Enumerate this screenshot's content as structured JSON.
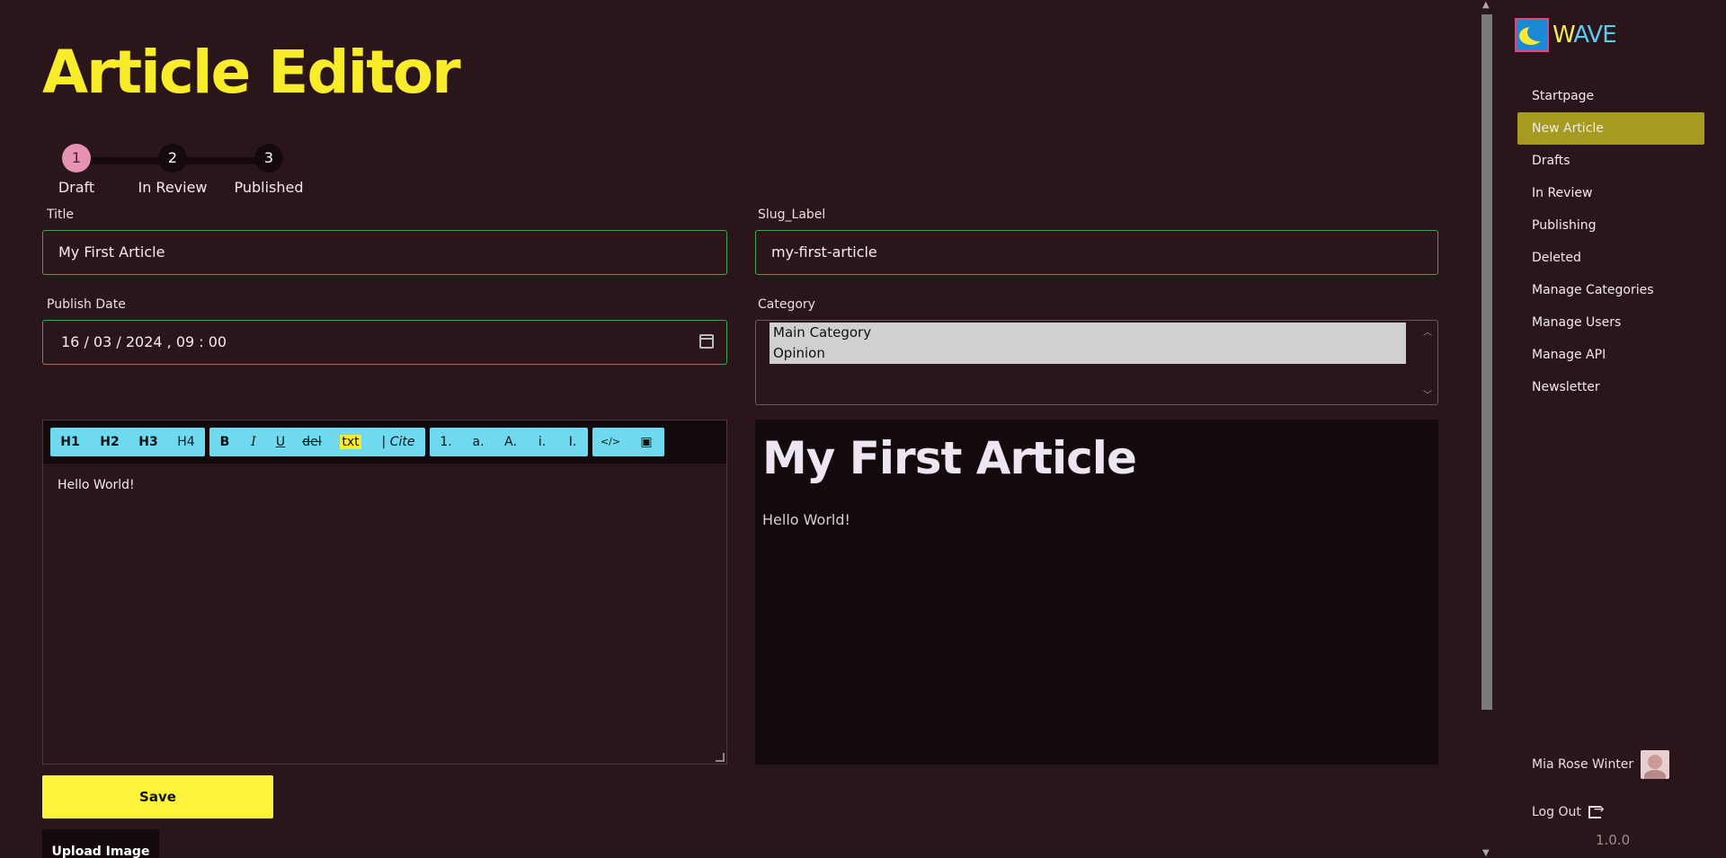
{
  "page": {
    "title": "Article Editor"
  },
  "stepper": {
    "steps": [
      {
        "number": "1",
        "label": "Draft",
        "active": true
      },
      {
        "number": "2",
        "label": "In Review",
        "active": false
      },
      {
        "number": "3",
        "label": "Published",
        "active": false
      }
    ]
  },
  "form": {
    "title_label": "Title",
    "title_value": "My First Article",
    "slug_label": "Slug_Label",
    "slug_value": "my-first-article",
    "date_label": "Publish Date",
    "date_value": "16 / 03 / 2024 ,  09 : 00",
    "category_label": "Category",
    "category_options": [
      "Main Category",
      "Opinion"
    ]
  },
  "toolbar": {
    "headings": [
      "H1",
      "H2",
      "H3",
      "H4"
    ],
    "format": [
      "B",
      "I",
      "U",
      "del",
      "txt",
      "| Cite"
    ],
    "lists": [
      "1.",
      "a.",
      "A.",
      "i.",
      "I."
    ],
    "code": [
      "</>",
      "▣"
    ]
  },
  "editor": {
    "content": "Hello World!"
  },
  "preview": {
    "title": "My First Article",
    "body": "Hello World!"
  },
  "actions": {
    "save": "Save",
    "upload": "Upload Image"
  },
  "sidebar": {
    "logo_text_a": "W",
    "logo_text_b": "AVE",
    "items": [
      "Startpage",
      "New Article",
      "Drafts",
      "In Review",
      "Publishing",
      "Deleted",
      "Manage Categories",
      "Manage Users",
      "Manage API",
      "Newsletter"
    ],
    "active_index": 1,
    "user_name": "Mia Rose Winter",
    "logout": "Log Out",
    "version": "1.0.0"
  },
  "colors": {
    "accent": "#f9ec2a",
    "active_nav": "#a59b20",
    "toolbar": "#6fd9ef",
    "step_active": "#e693b3"
  }
}
